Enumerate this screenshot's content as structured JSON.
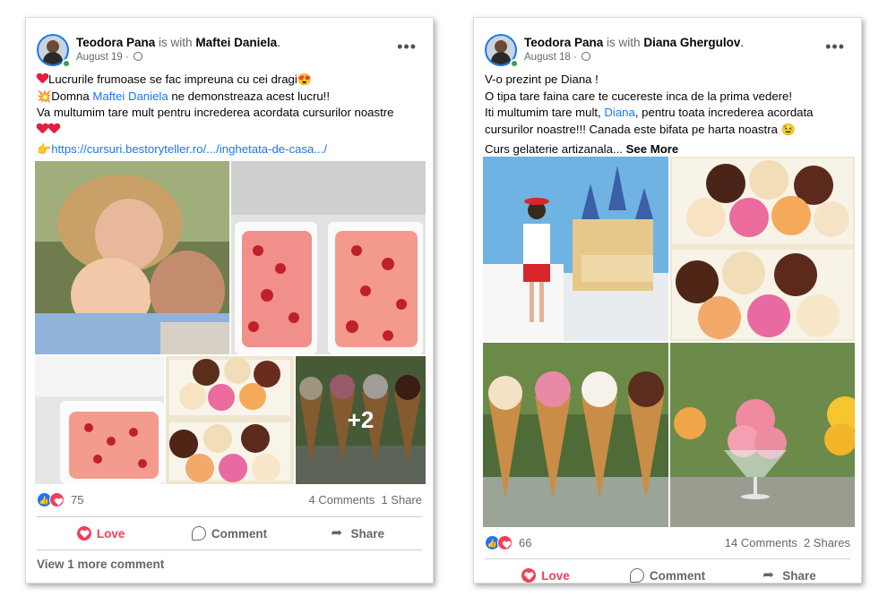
{
  "posts": [
    {
      "author": "Teodora Pana",
      "with_text": "is with",
      "tagged": "Maftei Daniela",
      "tagged_suffix": ".",
      "date": "August 19",
      "date_sep": "·",
      "more": "•••",
      "text": {
        "l1": "Lucrurile frumoase se fac impreuna cu cei dragi",
        "l1_emoji": "😍",
        "l2_emoji": "💥",
        "l2_a": "Domna ",
        "l2_link": "Maftei Daniela",
        "l2_b": " ne demonstreaza acest lucru!!",
        "l3": "Va multumim tare mult pentru increderea acordata cursurilor noastre",
        "l5_emoji": "👉",
        "url": "https://cursuri.bestoryteller.ro/.../inghetata-de-casa.../"
      },
      "photos_more": "+2",
      "reactions_count": "75",
      "comments": "4 Comments",
      "shares": "1 Share",
      "actions": {
        "love": "Love",
        "comment": "Comment",
        "share": "Share"
      },
      "view_more": "View 1 more comment"
    },
    {
      "author": "Teodora Pana",
      "with_text": "is with",
      "tagged": "Diana Ghergulov",
      "tagged_suffix": ".",
      "date": "August 18",
      "date_sep": "·",
      "more": "•••",
      "text": {
        "l1": "V-o prezint pe Diana !",
        "l2": "O tipa tare faina care te cucereste inca de la prima vedere!",
        "l3_a": "Iti multumim tare mult, ",
        "l3_link": "Diana",
        "l3_b": ", pentru toata increderea acordata",
        "l4": "cursurilor noastre!!! Canada este bifata pe harta noastra",
        "l4_emoji": "😉",
        "l5": "Curs gelaterie artizanala... ",
        "see_more": "See More"
      },
      "reactions_count": "66",
      "comments": "14 Comments",
      "shares": "2 Shares",
      "actions": {
        "love": "Love",
        "comment": "Comment",
        "share": "Share"
      }
    }
  ],
  "colors": {
    "facebook_blue": "#1877f2",
    "love_red": "#f33e58",
    "meta_gray": "#65676b"
  }
}
